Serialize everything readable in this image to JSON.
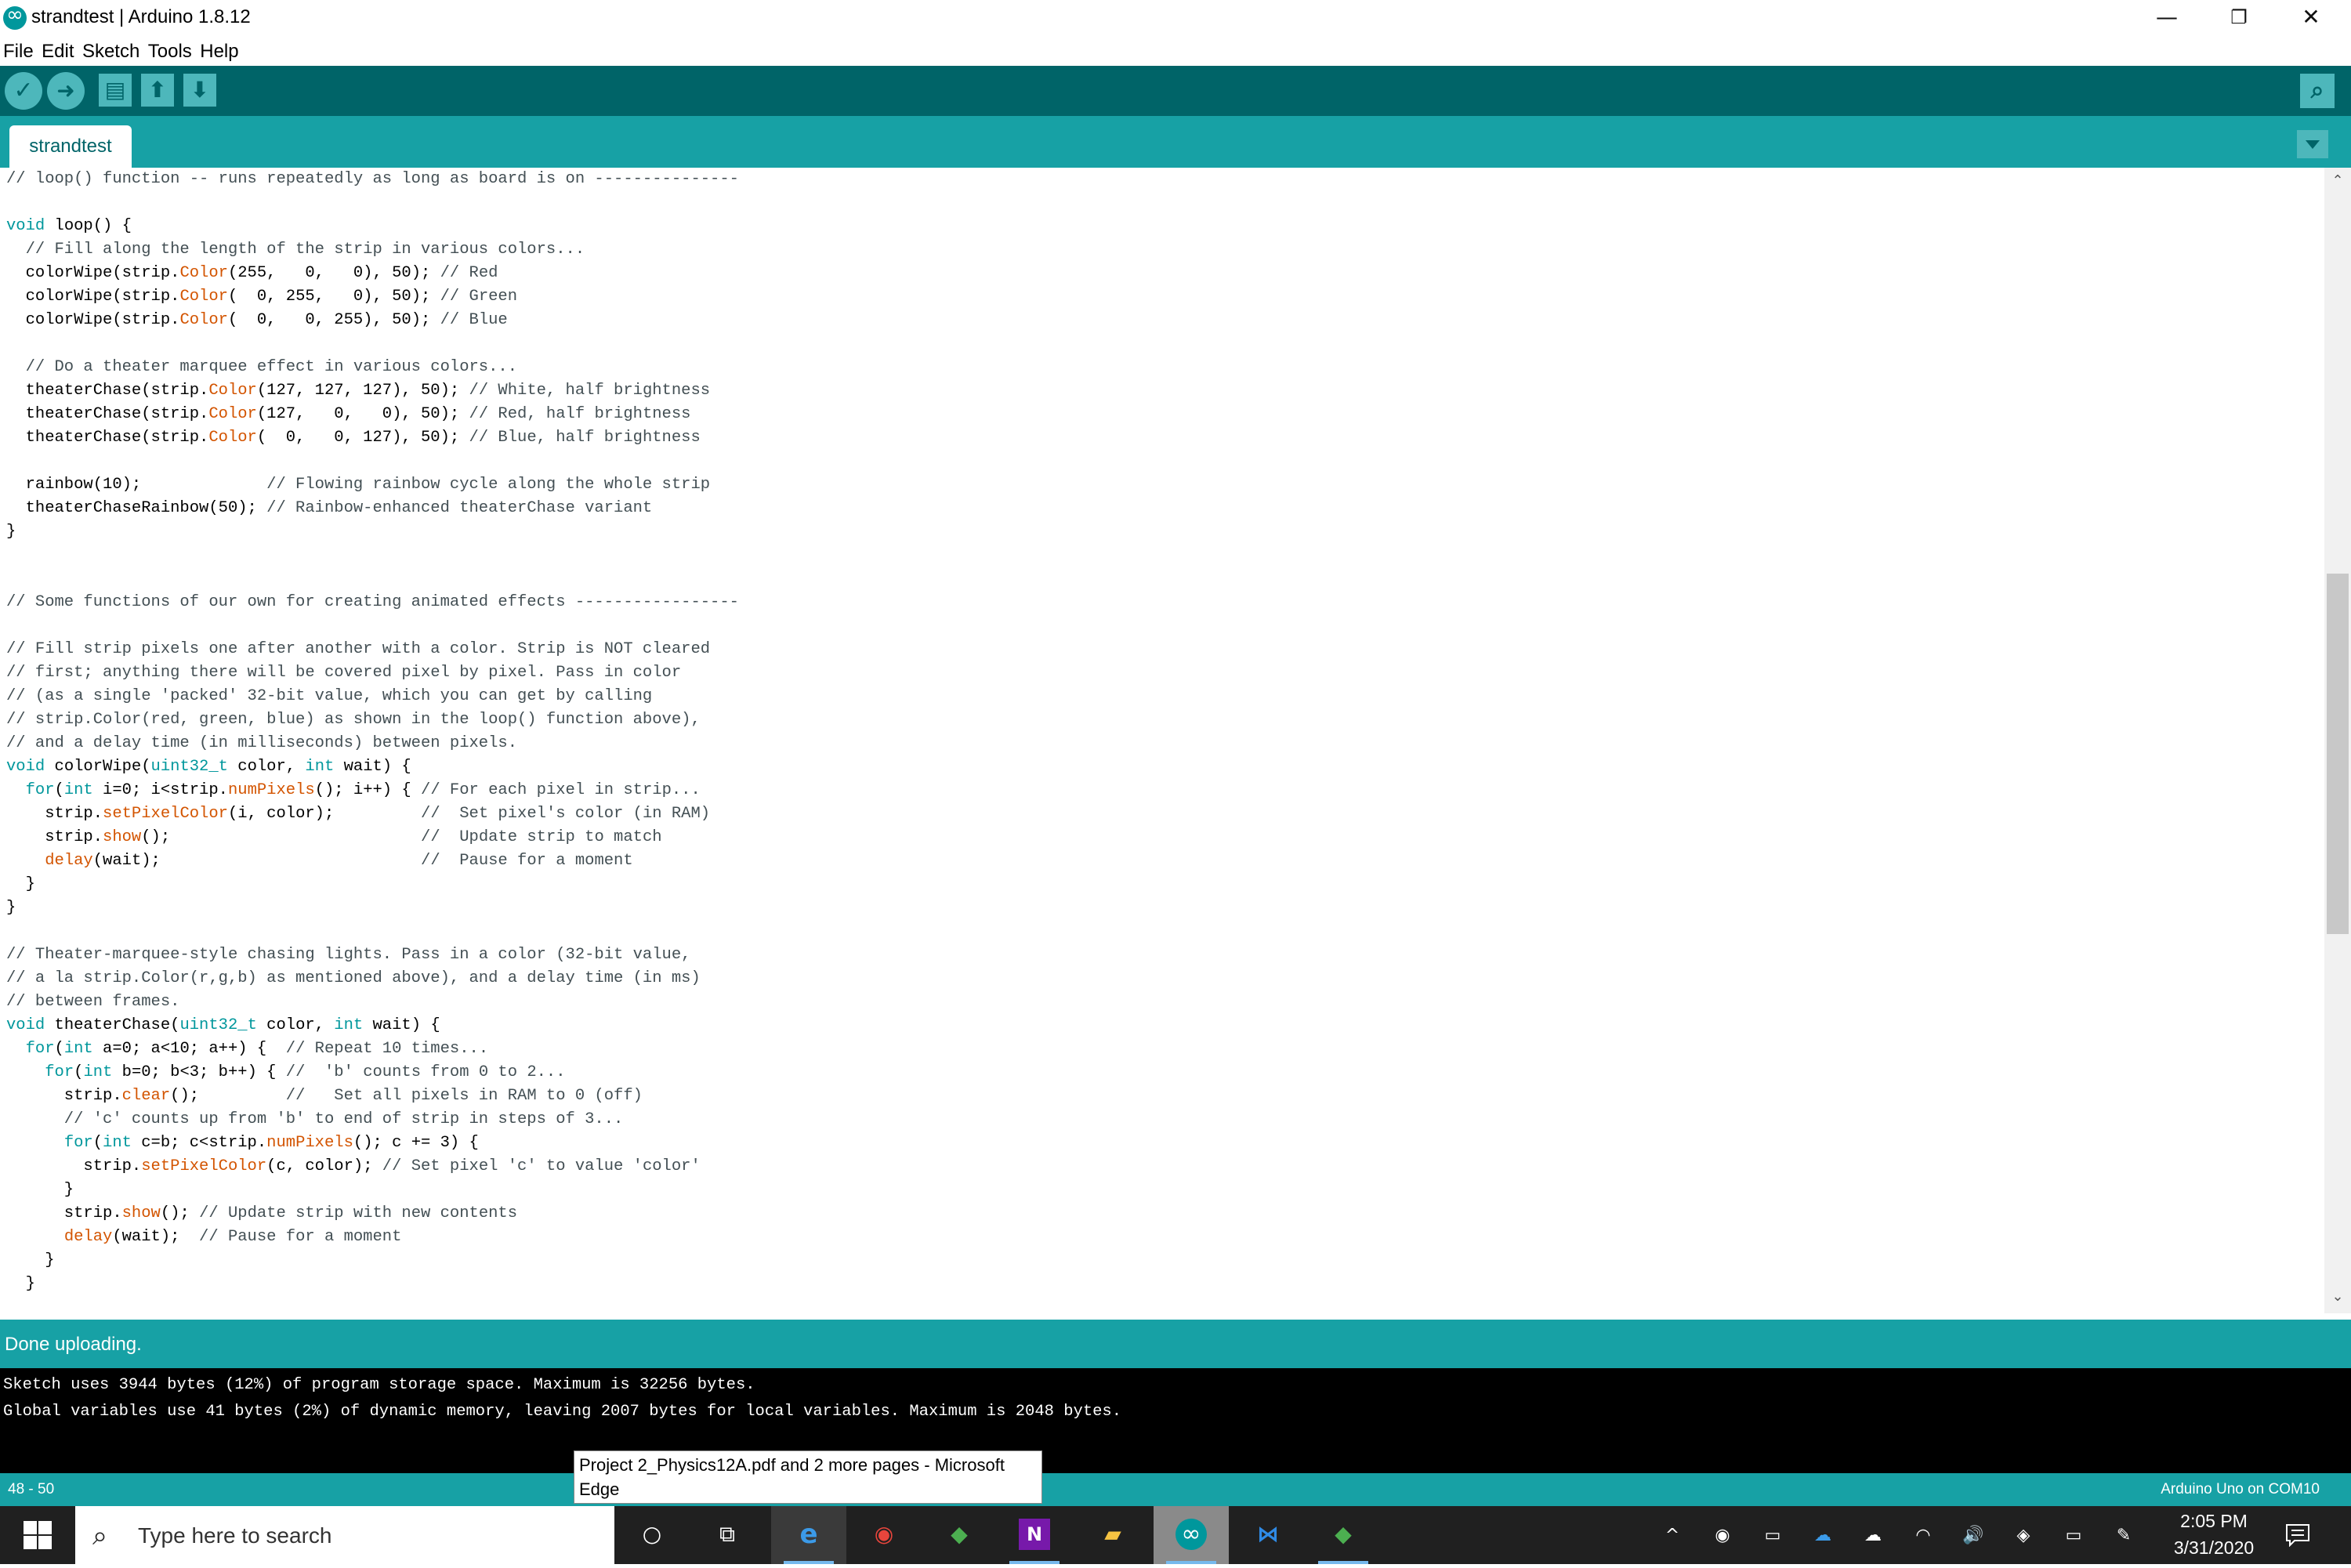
{
  "window": {
    "title": "strandtest | Arduino 1.8.12",
    "minimize_glyph": "—",
    "restore_glyph": "❐",
    "close_glyph": "✕"
  },
  "menu": [
    "File",
    "Edit",
    "Sketch",
    "Tools",
    "Help"
  ],
  "toolbar": {
    "buttons": [
      "verify",
      "upload",
      "new",
      "open",
      "save"
    ],
    "glyphs": [
      "✓",
      "➜",
      "▤",
      "⬆",
      "⬇"
    ],
    "serial_monitor_glyph": "⌕"
  },
  "tabs": [
    {
      "label": "strandtest"
    }
  ],
  "code": [
    [
      [
        "c",
        "// loop() function -- runs repeatedly as long as board is on ---------------"
      ]
    ],
    [],
    [
      [
        "k",
        "void"
      ],
      [
        "p",
        " loop() {"
      ]
    ],
    [
      [
        "c",
        "  // Fill along the length of the strip in various colors..."
      ]
    ],
    [
      [
        "p",
        "  colorWipe(strip."
      ],
      [
        "f",
        "Color"
      ],
      [
        "p",
        "(255,   0,   0), 50); "
      ],
      [
        "c",
        "// Red"
      ]
    ],
    [
      [
        "p",
        "  colorWipe(strip."
      ],
      [
        "f",
        "Color"
      ],
      [
        "p",
        "(  0, 255,   0), 50); "
      ],
      [
        "c",
        "// Green"
      ]
    ],
    [
      [
        "p",
        "  colorWipe(strip."
      ],
      [
        "f",
        "Color"
      ],
      [
        "p",
        "(  0,   0, 255), 50); "
      ],
      [
        "c",
        "// Blue"
      ]
    ],
    [],
    [
      [
        "c",
        "  // Do a theater marquee effect in various colors..."
      ]
    ],
    [
      [
        "p",
        "  theaterChase(strip."
      ],
      [
        "f",
        "Color"
      ],
      [
        "p",
        "(127, 127, 127), 50); "
      ],
      [
        "c",
        "// White, half brightness"
      ]
    ],
    [
      [
        "p",
        "  theaterChase(strip."
      ],
      [
        "f",
        "Color"
      ],
      [
        "p",
        "(127,   0,   0), 50); "
      ],
      [
        "c",
        "// Red, half brightness"
      ]
    ],
    [
      [
        "p",
        "  theaterChase(strip."
      ],
      [
        "f",
        "Color"
      ],
      [
        "p",
        "(  0,   0, 127), 50); "
      ],
      [
        "c",
        "// Blue, half brightness"
      ]
    ],
    [],
    [
      [
        "p",
        "  rainbow(10);             "
      ],
      [
        "c",
        "// Flowing rainbow cycle along the whole strip"
      ]
    ],
    [
      [
        "p",
        "  theaterChaseRainbow(50); "
      ],
      [
        "c",
        "// Rainbow-enhanced theaterChase variant"
      ]
    ],
    [
      [
        "p",
        "}"
      ]
    ],
    [],
    [],
    [
      [
        "c",
        "// Some functions of our own for creating animated effects -----------------"
      ]
    ],
    [],
    [
      [
        "c",
        "// Fill strip pixels one after another with a color. Strip is NOT cleared"
      ]
    ],
    [
      [
        "c",
        "// first; anything there will be covered pixel by pixel. Pass in color"
      ]
    ],
    [
      [
        "c",
        "// (as a single 'packed' 32-bit value, which you can get by calling"
      ]
    ],
    [
      [
        "c",
        "// strip.Color(red, green, blue) as shown in the loop() function above),"
      ]
    ],
    [
      [
        "c",
        "// and a delay time (in milliseconds) between pixels."
      ]
    ],
    [
      [
        "k",
        "void"
      ],
      [
        "p",
        " colorWipe("
      ],
      [
        "k",
        "uint32_t"
      ],
      [
        "p",
        " color, "
      ],
      [
        "k",
        "int"
      ],
      [
        "p",
        " wait) {"
      ]
    ],
    [
      [
        "p",
        "  "
      ],
      [
        "k",
        "for"
      ],
      [
        "p",
        "("
      ],
      [
        "k",
        "int"
      ],
      [
        "p",
        " i=0; i<strip."
      ],
      [
        "f",
        "numPixels"
      ],
      [
        "p",
        "(); i++) { "
      ],
      [
        "c",
        "// For each pixel in strip..."
      ]
    ],
    [
      [
        "p",
        "    strip."
      ],
      [
        "f",
        "setPixelColor"
      ],
      [
        "p",
        "(i, color);         "
      ],
      [
        "c",
        "//  Set pixel's color (in RAM)"
      ]
    ],
    [
      [
        "p",
        "    strip."
      ],
      [
        "f",
        "show"
      ],
      [
        "p",
        "();                          "
      ],
      [
        "c",
        "//  Update strip to match"
      ]
    ],
    [
      [
        "p",
        "    "
      ],
      [
        "f",
        "delay"
      ],
      [
        "p",
        "(wait);                           "
      ],
      [
        "c",
        "//  Pause for a moment"
      ]
    ],
    [
      [
        "p",
        "  }"
      ]
    ],
    [
      [
        "p",
        "}"
      ]
    ],
    [],
    [
      [
        "c",
        "// Theater-marquee-style chasing lights. Pass in a color (32-bit value,"
      ]
    ],
    [
      [
        "c",
        "// a la strip.Color(r,g,b) as mentioned above), and a delay time (in ms)"
      ]
    ],
    [
      [
        "c",
        "// between frames."
      ]
    ],
    [
      [
        "k",
        "void"
      ],
      [
        "p",
        " theaterChase("
      ],
      [
        "k",
        "uint32_t"
      ],
      [
        "p",
        " color, "
      ],
      [
        "k",
        "int"
      ],
      [
        "p",
        " wait) {"
      ]
    ],
    [
      [
        "p",
        "  "
      ],
      [
        "k",
        "for"
      ],
      [
        "p",
        "("
      ],
      [
        "k",
        "int"
      ],
      [
        "p",
        " a=0; a<10; a++) {  "
      ],
      [
        "c",
        "// Repeat 10 times..."
      ]
    ],
    [
      [
        "p",
        "    "
      ],
      [
        "k",
        "for"
      ],
      [
        "p",
        "("
      ],
      [
        "k",
        "int"
      ],
      [
        "p",
        " b=0; b<3; b++) { "
      ],
      [
        "c",
        "//  'b' counts from 0 to 2..."
      ]
    ],
    [
      [
        "p",
        "      strip."
      ],
      [
        "f",
        "clear"
      ],
      [
        "p",
        "();         "
      ],
      [
        "c",
        "//   Set all pixels in RAM to 0 (off)"
      ]
    ],
    [
      [
        "c",
        "      // 'c' counts up from 'b' to end of strip in steps of 3..."
      ]
    ],
    [
      [
        "p",
        "      "
      ],
      [
        "k",
        "for"
      ],
      [
        "p",
        "("
      ],
      [
        "k",
        "int"
      ],
      [
        "p",
        " c=b; c<strip."
      ],
      [
        "f",
        "numPixels"
      ],
      [
        "p",
        "(); c += 3) {"
      ]
    ],
    [
      [
        "p",
        "        strip."
      ],
      [
        "f",
        "setPixelColor"
      ],
      [
        "p",
        "(c, color); "
      ],
      [
        "c",
        "// Set pixel 'c' to value 'color'"
      ]
    ],
    [
      [
        "p",
        "      }"
      ]
    ],
    [
      [
        "p",
        "      strip."
      ],
      [
        "f",
        "show"
      ],
      [
        "p",
        "(); "
      ],
      [
        "c",
        "// Update strip with new contents"
      ]
    ],
    [
      [
        "p",
        "      "
      ],
      [
        "f",
        "delay"
      ],
      [
        "p",
        "(wait);  "
      ],
      [
        "c",
        "// Pause for a moment"
      ]
    ],
    [
      [
        "p",
        "    }"
      ]
    ],
    [
      [
        "p",
        "  }"
      ]
    ]
  ],
  "status": {
    "message": "Done uploading.",
    "console": [
      "Sketch uses 3944 bytes (12%) of program storage space. Maximum is 32256 bytes.",
      "Global variables use 41 bytes (2%) of dynamic memory, leaving 2007 bytes for local variables. Maximum is 2048 bytes."
    ],
    "line_range": "48 - 50",
    "board_port": "Arduino Uno on COM10"
  },
  "tooltip": {
    "line1": "Project 2_Physics12A.pdf and 2 more pages - Microsoft",
    "line2": "Edge"
  },
  "taskbar": {
    "search_placeholder": "Type here to search",
    "apps": [
      "cortana",
      "task-view",
      "microsoft-edge",
      "google-chrome",
      "git-app",
      "onenote",
      "file-explorer",
      "arduino",
      "vs-code",
      "git-app-2"
    ],
    "app_glyphs": [
      "○",
      "⧉",
      "e",
      "◉",
      "◆",
      "N",
      "▰",
      "∞",
      "⋈",
      "◆"
    ],
    "tray": [
      "chevron-up",
      "record",
      "display",
      "onedrive",
      "cloud-error",
      "wifi",
      "volume",
      "dropbox",
      "battery",
      "pen"
    ],
    "tray_glyphs": [
      "^",
      "◉",
      "▭",
      "☁",
      "☁",
      "◠",
      "🔊",
      "◈",
      "▭",
      "✎"
    ],
    "time": "2:05 PM",
    "date": "3/31/2020"
  },
  "colors": {
    "toolbar_bg": "#006468",
    "tab_bar_bg": "#17a1a5",
    "button_bg": "#4db7bb",
    "keyword": "#00979c",
    "function": "#d35400",
    "comment": "#434f54"
  }
}
